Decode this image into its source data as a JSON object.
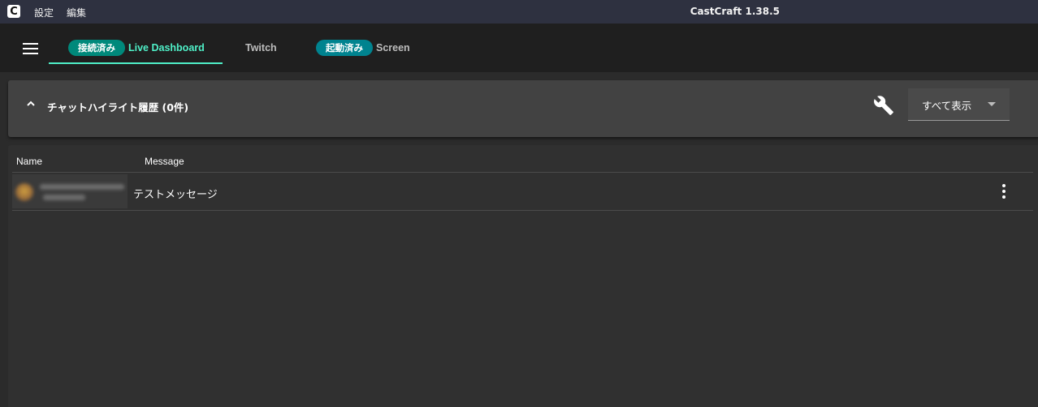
{
  "titlebar": {
    "logo": "C",
    "menu": [
      "設定",
      "編集"
    ],
    "window_title": "CastCraft 1.38.5"
  },
  "tabs": [
    {
      "badge": "接続済み",
      "label": "Live Dashboard",
      "active": true,
      "badge_color": "#00897b",
      "label_color": "#4ff0c8"
    },
    {
      "badge": "",
      "label": "Twitch",
      "active": false,
      "label_color": "#bdbdbd"
    },
    {
      "badge": "起動済み",
      "label": "Screen",
      "active": false,
      "badge_color": "#00838f",
      "label_color": "#bdbdbd"
    }
  ],
  "panel": {
    "title": "チャットハイライト履歴 (0件)",
    "filter_select": {
      "value": "すべて表示"
    }
  },
  "table": {
    "columns": [
      "Name",
      "Message"
    ],
    "rows": [
      {
        "message": "テストメッセージ"
      }
    ]
  },
  "icons": [
    "menu-icon",
    "chevron-up-icon",
    "wrench-icon",
    "caret-down-icon",
    "more-vert-icon"
  ]
}
